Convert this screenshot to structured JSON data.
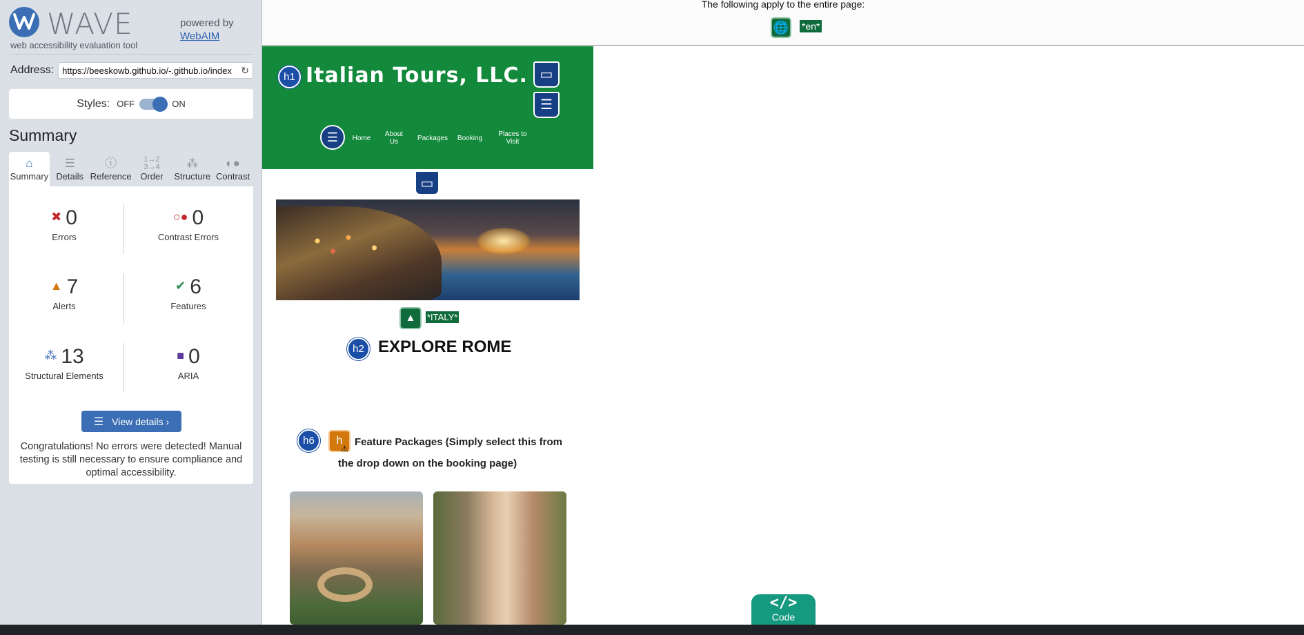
{
  "wave": {
    "brand": "WAVE",
    "tagline": "web accessibility evaluation tool",
    "powered_by": "powered by",
    "webaim_link": "WebAIM",
    "address_label": "Address:",
    "address_value": "https://beeskowb.github.io/-.github.io/index",
    "styles_label": "Styles:",
    "styles_off": "OFF",
    "styles_on": "ON",
    "summary_title": "Summary",
    "tabs": [
      {
        "label": "Summary",
        "icon": "home-icon"
      },
      {
        "label": "Details",
        "icon": "list-icon"
      },
      {
        "label": "Reference",
        "icon": "info-icon"
      },
      {
        "label": "Order",
        "icon": "order-icon"
      },
      {
        "label": "Structure",
        "icon": "structure-icon"
      },
      {
        "label": "Contrast",
        "icon": "contrast-icon"
      }
    ],
    "stats": {
      "errors": {
        "count": "0",
        "label": "Errors"
      },
      "contrast_errors": {
        "count": "0",
        "label": "Contrast Errors"
      },
      "alerts": {
        "count": "7",
        "label": "Alerts"
      },
      "features": {
        "count": "6",
        "label": "Features"
      },
      "structural": {
        "count": "13",
        "label": "Structural Elements"
      },
      "aria": {
        "count": "0",
        "label": "ARIA"
      }
    },
    "view_details": "View details ›",
    "congrats": "Congratulations! No errors were detected! Manual testing is still necessary to ensure compliance and optimal accessibility.",
    "colors": {
      "accent": "#3b6eb4",
      "error": "#c1272d",
      "alert": "#d3780c",
      "feature": "#2e8b57",
      "aria": "#5b3a9b"
    }
  },
  "page": {
    "note": "The following apply to the entire page:",
    "lang_badge": "*en*",
    "h1_badge": "h1",
    "h2_badge": "h2",
    "h6_badge": "h6",
    "site_title": "Italian Tours, LLC.",
    "nav": [
      {
        "label": "Home"
      },
      {
        "label": "About Us"
      },
      {
        "label": "Packages"
      },
      {
        "label": "Booking"
      },
      {
        "label": "Places to Visit"
      }
    ],
    "alt_badge": "*ITALY*",
    "explore_heading": "EXPLORE ROME",
    "feature_packages": "Feature Packages (Simply select this from the drop down on the booking page)",
    "code_button": "Code",
    "colors": {
      "header_green": "#12893b",
      "badge_blue": "#1b4ea6",
      "alt_green": "#0f6b3c",
      "code_teal": "#159a80"
    }
  }
}
